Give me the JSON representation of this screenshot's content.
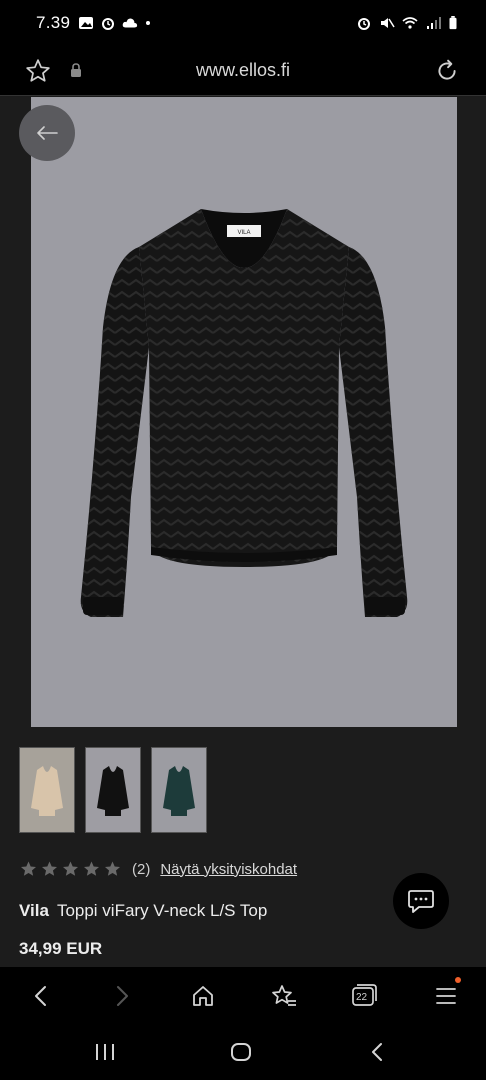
{
  "status_bar": {
    "time": "7.39"
  },
  "browser": {
    "url": "www.ellos.fi",
    "tab_count": "22"
  },
  "product": {
    "rating_count": "(2)",
    "details_link": "Näytä yksityiskohdat",
    "brand": "Vila",
    "name": "Toppi viFary V-neck L/S Top",
    "price": "34,99 EUR",
    "label_text": "VILA",
    "thumbnails": [
      {
        "color": "#d8c4aa"
      },
      {
        "color": "#111111"
      },
      {
        "color": "#1d3b3a"
      }
    ]
  },
  "colors": {
    "background": "#1c1c1c",
    "hero_background": "#9c9ca3",
    "accent_dot": "#f0602b"
  }
}
